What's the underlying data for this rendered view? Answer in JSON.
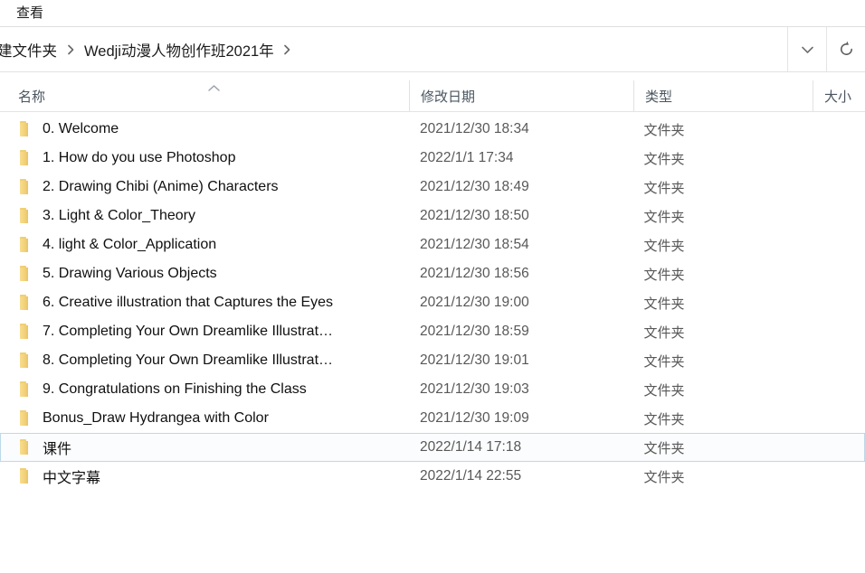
{
  "window": {
    "ribbon_tabs": [
      {
        "label": "查看",
        "name": "tab-view"
      }
    ]
  },
  "address_bar": {
    "breadcrumbs": [
      {
        "label": "建文件夹",
        "clipped": true
      },
      {
        "label": "Wedji动漫人物创作班2021年",
        "clipped": false
      }
    ],
    "separator_icon": "chevron-right-icon",
    "history_dropdown_icon": "chevron-down-icon",
    "refresh_icon": "refresh-icon"
  },
  "columns": [
    {
      "label": "名称",
      "name": "column-header-name",
      "sorted": true,
      "sort_direction": "ascending"
    },
    {
      "label": "修改日期",
      "name": "column-header-date",
      "sorted": false,
      "sort_direction": ""
    },
    {
      "label": "类型",
      "name": "column-header-type",
      "sorted": false,
      "sort_direction": ""
    },
    {
      "label": "大小",
      "name": "column-header-size",
      "sorted": false,
      "sort_direction": ""
    }
  ],
  "colors": {
    "folder_icon": "#f3d27a",
    "selection_border": "#bcd9e8",
    "selection_background": "#fbfcfd",
    "header_text": "#4a5560",
    "secondary_text": "#585858"
  },
  "files": [
    {
      "name": "0. Welcome",
      "date": "2021/12/30 18:34",
      "type": "文件夹",
      "size": "",
      "icon": "folder-icon",
      "selected": false
    },
    {
      "name": "1. How do you use Photoshop",
      "date": "2022/1/1 17:34",
      "type": "文件夹",
      "size": "",
      "icon": "folder-icon",
      "selected": false
    },
    {
      "name": "2. Drawing Chibi (Anime) Characters",
      "date": "2021/12/30 18:49",
      "type": "文件夹",
      "size": "",
      "icon": "folder-icon",
      "selected": false
    },
    {
      "name": "3. Light & Color_Theory",
      "date": "2021/12/30 18:50",
      "type": "文件夹",
      "size": "",
      "icon": "folder-icon",
      "selected": false
    },
    {
      "name": "4. light & Color_Application",
      "date": "2021/12/30 18:54",
      "type": "文件夹",
      "size": "",
      "icon": "folder-icon",
      "selected": false
    },
    {
      "name": "5. Drawing Various Objects",
      "date": "2021/12/30 18:56",
      "type": "文件夹",
      "size": "",
      "icon": "folder-icon",
      "selected": false
    },
    {
      "name": "6. Creative illustration that Captures the Eyes",
      "date": "2021/12/30 19:00",
      "type": "文件夹",
      "size": "",
      "icon": "folder-icon",
      "selected": false
    },
    {
      "name": "7. Completing Your Own Dreamlike Illustrat…",
      "date": "2021/12/30 18:59",
      "type": "文件夹",
      "size": "",
      "icon": "folder-icon",
      "selected": false
    },
    {
      "name": "8. Completing Your Own Dreamlike Illustrat…",
      "date": "2021/12/30 19:01",
      "type": "文件夹",
      "size": "",
      "icon": "folder-icon",
      "selected": false
    },
    {
      "name": "9. Congratulations on Finishing the Class",
      "date": "2021/12/30 19:03",
      "type": "文件夹",
      "size": "",
      "icon": "folder-icon",
      "selected": false
    },
    {
      "name": "Bonus_Draw Hydrangea with Color",
      "date": "2021/12/30 19:09",
      "type": "文件夹",
      "size": "",
      "icon": "folder-icon",
      "selected": false
    },
    {
      "name": "课件",
      "date": "2022/1/14 17:18",
      "type": "文件夹",
      "size": "",
      "icon": "folder-icon",
      "selected": true
    },
    {
      "name": "中文字幕",
      "date": "2022/1/14 22:55",
      "type": "文件夹",
      "size": "",
      "icon": "folder-icon",
      "selected": false
    }
  ]
}
